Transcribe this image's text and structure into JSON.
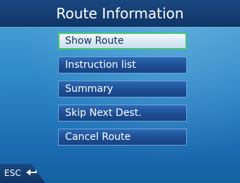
{
  "header": {
    "title": "Route Information"
  },
  "menu": {
    "items": [
      {
        "label": "Show Route",
        "selected": true
      },
      {
        "label": "Instruction list"
      },
      {
        "label": "Summary"
      },
      {
        "label": "Skip Next Dest."
      },
      {
        "label": "Cancel Route"
      }
    ]
  },
  "footer": {
    "esc_label": "ESC",
    "esc_icon": "return-arrow-icon"
  },
  "colors": {
    "background": "#2d86c6",
    "title_bar": "#103566",
    "button": "#1d4d93",
    "selected_border": "#46c66a"
  }
}
